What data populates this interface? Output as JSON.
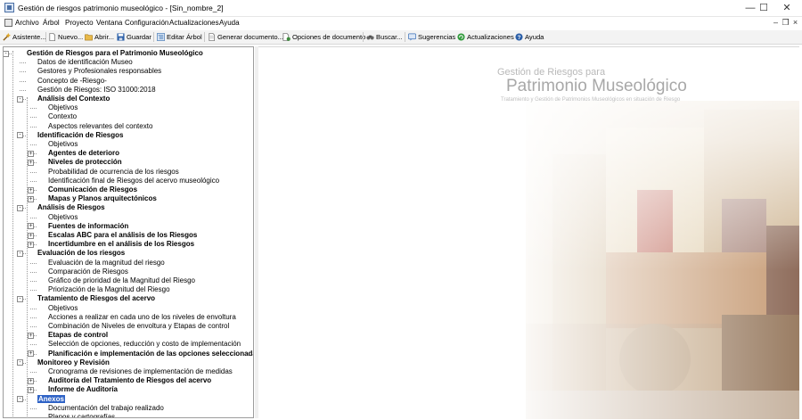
{
  "window": {
    "title": "Gestión de riesgos patrimonio museológico - [Sin_nombre_2]",
    "minimize_glyph": "—",
    "maximize_glyph": "☐",
    "close_glyph": "✕"
  },
  "menubar": {
    "items": [
      "Archivo",
      "Árbol",
      "Proyecto",
      "Ventana",
      "Configuración",
      "Actualizaciones",
      "Ayuda"
    ],
    "mdi_minimize": "–",
    "mdi_restore": "❐",
    "mdi_close": "×"
  },
  "toolbar": {
    "buttons": [
      {
        "label": "Asistente...",
        "icon": "wand-icon",
        "color": "#c78a1a"
      },
      {
        "label": "Nuevo...",
        "icon": "new-document-icon",
        "color": "#7a7a7a"
      },
      {
        "label": "Abrir...",
        "icon": "open-folder-icon",
        "color": "#d9a52b"
      },
      {
        "label": "Guardar",
        "icon": "save-icon",
        "color": "#2b5fa8"
      },
      {
        "label": "Editar Árbol",
        "icon": "tree-edit-icon",
        "color": "#4c7db8"
      },
      {
        "label": "Generar documento...",
        "icon": "document-icon",
        "color": "#7a7a7a"
      },
      {
        "label": "Opciones de documento",
        "icon": "document-options-icon",
        "color": "#3d8a3d"
      },
      {
        "label": "Buscar...",
        "icon": "binoculars-icon",
        "color": "#555555"
      },
      {
        "label": "Sugerencias",
        "icon": "suggestions-icon",
        "color": "#3a6fb8"
      },
      {
        "label": "Actualizaciones",
        "icon": "update-icon",
        "color": "#2e9a3a"
      },
      {
        "label": "Ayuda",
        "icon": "help-icon",
        "color": "#2b5fa8"
      }
    ]
  },
  "tree": {
    "items": [
      {
        "label": "Gestión de Riesgos para el Patrimonio Museológico",
        "level": 0,
        "bold": true,
        "expander": "-"
      },
      {
        "label": "Datos de identificación Museo",
        "level": 1,
        "bold": false,
        "expander": ""
      },
      {
        "label": "Gestores y Profesionales responsables",
        "level": 1,
        "bold": false,
        "expander": ""
      },
      {
        "label": "Concepto de -Riesgo-",
        "level": 1,
        "bold": false,
        "expander": ""
      },
      {
        "label": "Gestión de Riesgos: ISO 31000:2018",
        "level": 1,
        "bold": false,
        "expander": ""
      },
      {
        "label": "Análisis del Contexto",
        "level": 1,
        "bold": true,
        "expander": "-"
      },
      {
        "label": "Objetivos",
        "level": 2,
        "bold": false,
        "expander": ""
      },
      {
        "label": "Contexto",
        "level": 2,
        "bold": false,
        "expander": ""
      },
      {
        "label": "Aspectos relevantes del contexto",
        "level": 2,
        "bold": false,
        "expander": ""
      },
      {
        "label": "Identificación de Riesgos",
        "level": 1,
        "bold": true,
        "expander": "-"
      },
      {
        "label": "Objetivos",
        "level": 2,
        "bold": false,
        "expander": ""
      },
      {
        "label": "Agentes de deterioro",
        "level": 2,
        "bold": true,
        "expander": "+"
      },
      {
        "label": "Niveles de protección",
        "level": 2,
        "bold": true,
        "expander": "+"
      },
      {
        "label": "Probabilidad de ocurrencia de los riesgos",
        "level": 2,
        "bold": false,
        "expander": ""
      },
      {
        "label": "Identificación final de Riesgos del acervo museológico",
        "level": 2,
        "bold": false,
        "expander": ""
      },
      {
        "label": "Comunicación de Riesgos",
        "level": 2,
        "bold": true,
        "expander": "+"
      },
      {
        "label": "Mapas y Planos arquitectónicos",
        "level": 2,
        "bold": true,
        "expander": "+"
      },
      {
        "label": "Análisis de Riesgos",
        "level": 1,
        "bold": true,
        "expander": "-"
      },
      {
        "label": "Objetivos",
        "level": 2,
        "bold": false,
        "expander": ""
      },
      {
        "label": "Fuentes de información",
        "level": 2,
        "bold": true,
        "expander": "+"
      },
      {
        "label": "Escalas ABC para el análisis de los Riesgos",
        "level": 2,
        "bold": true,
        "expander": "+"
      },
      {
        "label": "Incertidumbre en el análisis de los Riesgos",
        "level": 2,
        "bold": true,
        "expander": "+"
      },
      {
        "label": "Evaluación de los riesgos",
        "level": 1,
        "bold": true,
        "expander": "-"
      },
      {
        "label": "Evaluación de la magnitud del riesgo",
        "level": 2,
        "bold": false,
        "expander": ""
      },
      {
        "label": "Comparación de Riesgos",
        "level": 2,
        "bold": false,
        "expander": ""
      },
      {
        "label": "Gráfico de prioridad de la Magnitud del Riesgo",
        "level": 2,
        "bold": false,
        "expander": ""
      },
      {
        "label": "Priorización de la Magnitud del Riesgo",
        "level": 2,
        "bold": false,
        "expander": ""
      },
      {
        "label": "Tratamiento de Riesgos del acervo",
        "level": 1,
        "bold": true,
        "expander": "-"
      },
      {
        "label": "Objetivos",
        "level": 2,
        "bold": false,
        "expander": ""
      },
      {
        "label": "Acciones a realizar en cada uno de los niveles de envoltura",
        "level": 2,
        "bold": false,
        "expander": ""
      },
      {
        "label": "Combinación de Niveles de envoltura y Etapas de control",
        "level": 2,
        "bold": false,
        "expander": ""
      },
      {
        "label": "Etapas de control",
        "level": 2,
        "bold": true,
        "expander": "+"
      },
      {
        "label": "Selección de opciones, reducción y costo de implementación",
        "level": 2,
        "bold": false,
        "expander": ""
      },
      {
        "label": "Planificación e implementación de las opciones seleccionadas",
        "level": 2,
        "bold": true,
        "expander": "+"
      },
      {
        "label": "Monitoreo y Revisión",
        "level": 1,
        "bold": true,
        "expander": "-"
      },
      {
        "label": "Cronograma de revisiones de implementación de medidas",
        "level": 2,
        "bold": false,
        "expander": ""
      },
      {
        "label": "Auditoría del Tratamiento de Riesgos del acervo",
        "level": 2,
        "bold": true,
        "expander": "+"
      },
      {
        "label": "Informe de Auditoría",
        "level": 2,
        "bold": true,
        "expander": "+"
      },
      {
        "label": "Anexos",
        "level": 1,
        "bold": true,
        "expander": "-",
        "selected": true
      },
      {
        "label": "Documentación del trabajo realizado",
        "level": 2,
        "bold": false,
        "expander": ""
      },
      {
        "label": "Planos y cartografías",
        "level": 2,
        "bold": false,
        "expander": ""
      }
    ]
  },
  "content": {
    "watermark_line1": "Gestión de Riesgos para",
    "watermark_line2": "Patrimonio Museológico",
    "watermark_line3": "Tratamiento y Gestión de Patrimonios Museológicos en situación de Riesgo"
  },
  "colors": {
    "selection": "#2f63c6",
    "fresco_red": "#b85a4a",
    "fresco_ochre": "#d9b98a"
  }
}
